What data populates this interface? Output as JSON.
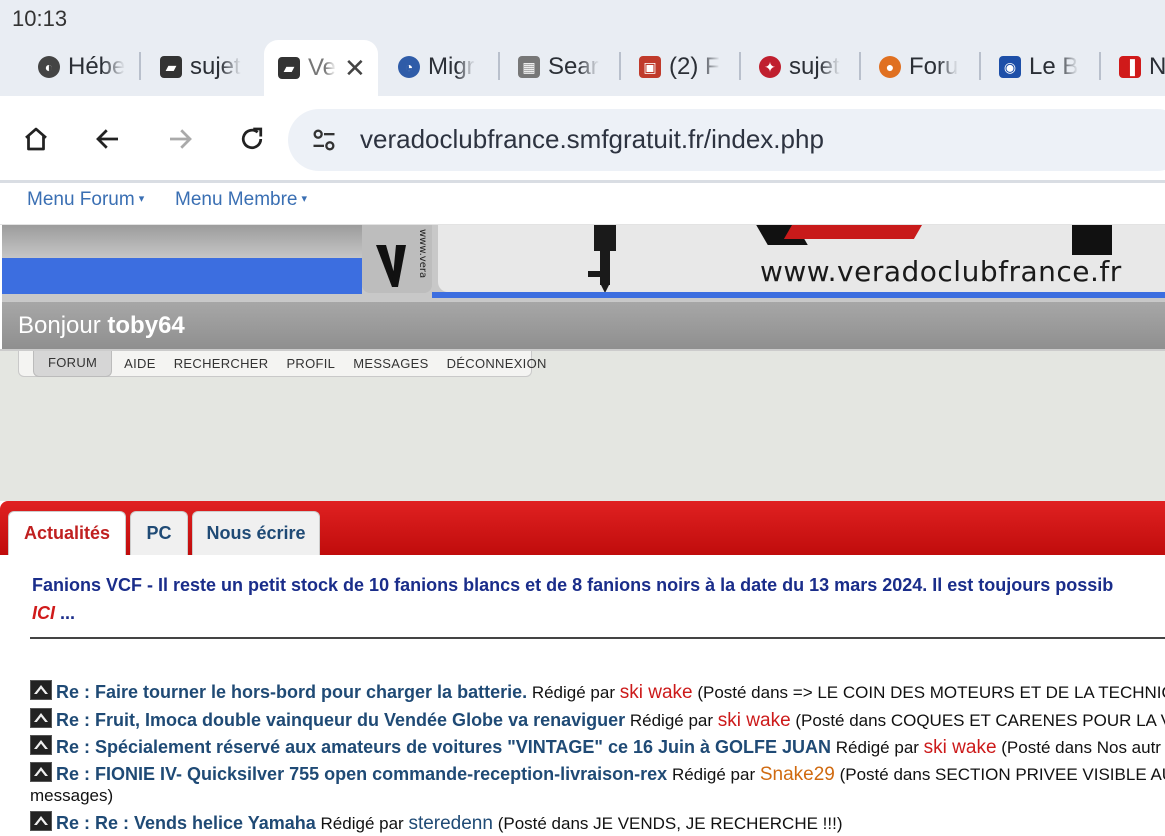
{
  "status_bar": {
    "time": "10:13"
  },
  "tabs": [
    {
      "title": "Hébe",
      "favicon": "globe-icon",
      "color": "#555"
    },
    {
      "title": "sujet",
      "favicon": "vcf-logo-icon",
      "color": "#444"
    },
    {
      "title": "Ve",
      "favicon": "vcf-logo-icon",
      "color": "#444",
      "active": true,
      "close": "✕"
    },
    {
      "title": "Migr",
      "favicon": "migrate-icon",
      "color": "#2f5ca8"
    },
    {
      "title": "Sear",
      "favicon": "search-tool-icon",
      "color": "#666"
    },
    {
      "title": "(2) F",
      "favicon": "forum-icon",
      "color": "#c03a2b"
    },
    {
      "title": "sujet",
      "favicon": "red-logo-icon",
      "color": "#c01f2e"
    },
    {
      "title": "Foru",
      "favicon": "forum-orange-icon",
      "color": "#e07020"
    },
    {
      "title": "Le B",
      "favicon": "club-icon",
      "color": "#1d4fa8"
    },
    {
      "title": "N",
      "favicon": "news-icon",
      "color": "#d01a1a"
    }
  ],
  "toolbar": {
    "url": "veradoclubfrance.smfgratuit.fr/index.php"
  },
  "forum_menu": {
    "items": [
      {
        "label": "Menu Forum"
      },
      {
        "label": "Menu Membre"
      }
    ]
  },
  "banner": {
    "www": "www.veradoclubfrance.fr",
    "logo_side_text": "www.vera"
  },
  "greeting": {
    "prefix": "Bonjour",
    "user": "toby64"
  },
  "nav": {
    "items": [
      "FORUM",
      "AIDE",
      "RECHERCHER",
      "PROFIL",
      "MESSAGES",
      "DÉCONNEXION"
    ]
  },
  "content_tabs": [
    "Actualités",
    "PC",
    "Nous écrire"
  ],
  "news": {
    "text": "Fanions VCF - Il reste un petit stock de 10 fanions blancs et de 8 fanions noirs à la date du 13 mars 2024. Il est toujours possib",
    "link": "ICI",
    "after": " ..."
  },
  "posts": [
    {
      "title": "Re : Faire tourner le hors-bord pour charger la batterie.",
      "by": "Rédigé par",
      "author": "ski wake",
      "author_color": "red",
      "posted": "(Posté dans => LE COIN DES MOTEURS ET DE LA TECHNIQU"
    },
    {
      "title": "Re : Fruit, Imoca double vainqueur du Vendée Globe va renaviguer",
      "by": "Rédigé par",
      "author": "ski wake",
      "author_color": "red",
      "posted": "(Posté dans COQUES ET CARENES POUR LA VC"
    },
    {
      "title": "Re : Spécialement réservé aux amateurs de voitures \"VINTAGE\" ce 16 Juin à GOLFE JUAN",
      "by": "Rédigé par",
      "author": "ski wake",
      "author_color": "red",
      "posted": "(Posté dans Nos autr"
    },
    {
      "title": "Re : FIONIE IV- Quicksilver 755 open commande-reception-livraison-rex",
      "by": "Rédigé par",
      "author": "Snake29",
      "author_color": "orange",
      "posted": "(Posté dans SECTION PRIVEE VISIBLE AU",
      "continued": "messages)"
    },
    {
      "title": "Re : Re : Vends helice Yamaha",
      "by": "Rédigé par",
      "author": "steredenn",
      "author_color": "blue",
      "posted": "(Posté dans JE VENDS, JE RECHERCHE !!!)"
    }
  ]
}
